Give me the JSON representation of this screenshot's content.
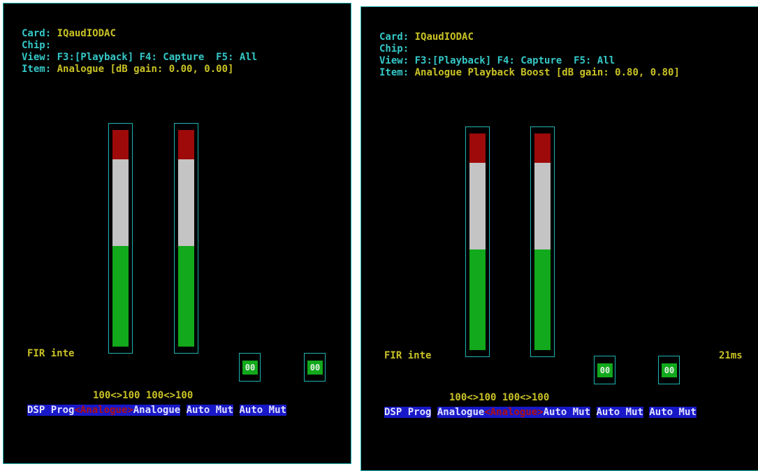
{
  "panels": [
    {
      "card_label": "Card:",
      "card_value": "IQaudIODAC",
      "chip_label": "Chip:",
      "view_label": "View:",
      "view_value": "F3:[Playback] F4: Capture  F5: All",
      "item_label": "Item:",
      "item_value": "Analogue [dB gain: 0.00, 0.00]",
      "meter_levels": [
        {
          "green": 0.46,
          "white": 0.4,
          "red": 0.14
        },
        {
          "green": 0.46,
          "white": 0.4,
          "red": 0.14
        }
      ],
      "fir_label": "FIR inte",
      "switch_values": [
        "00",
        "00"
      ],
      "vol_values": "100<>100 100<>100",
      "names": {
        "first": "DSP Prog",
        "left_bracket": "<",
        "selected": "Analogue",
        "right_bracket": ">",
        "second": "Analogue",
        "third": "Auto Mut",
        "fourth": "Auto Mut"
      }
    },
    {
      "card_label": "Card:",
      "card_value": "IQaudIODAC",
      "chip_label": "Chip:",
      "view_label": "View:",
      "view_value": "F3:[Playback] F4: Capture  F5: All",
      "item_label": "Item:",
      "item_value": "Analogue Playback Boost [dB gain: 0.80, 0.80]",
      "meter_levels": [
        {
          "green": 0.46,
          "white": 0.4,
          "red": 0.14
        },
        {
          "green": 0.46,
          "white": 0.4,
          "red": 0.14
        }
      ],
      "fir_label": "FIR inte",
      "ms_label": "21ms",
      "switch_values": [
        "00",
        "00"
      ],
      "vol_values": "100<>100 100<>100",
      "names": {
        "first": "DSP Prog",
        "second": "Analogue",
        "left_bracket": "<",
        "selected": "Analogue",
        "right_bracket": ">",
        "third": "Auto Mut",
        "fourth": "Auto Mut",
        "fifth": "Auto Mut"
      }
    }
  ],
  "colors": {
    "background": "#000000",
    "border": "#1fb3b3",
    "label_cyan": "#35c8c8",
    "value_yellow": "#c9c226",
    "meter_red": "#9e0a0a",
    "meter_white": "#c4c4c4",
    "meter_green": "#12a91c",
    "name_bg_blue": "#1818c8",
    "selected_red": "#b01010"
  }
}
